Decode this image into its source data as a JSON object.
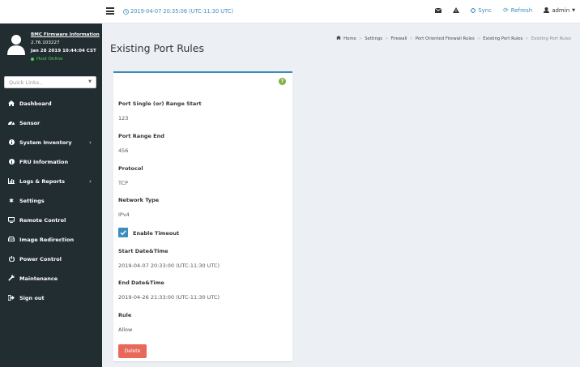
{
  "topbar": {
    "datetime": "2019-04-07 20:35:06 (UTC-11:30 UTC)",
    "sync_label": "Sync",
    "refresh_label": "Refresh",
    "user_label": "admin"
  },
  "user_panel": {
    "title": "BMC Firmware Information",
    "version": "2.76.103227",
    "build_date": "Jan 28 2019 10:44:04 CST",
    "host_status": "Host Online"
  },
  "quick_links": {
    "placeholder": "Quick Links.."
  },
  "sidebar": {
    "items": [
      {
        "label": "Dashboard",
        "icon": "dashboard-icon"
      },
      {
        "label": "Sensor",
        "icon": "sensor-icon"
      },
      {
        "label": "System Inventory",
        "icon": "info-icon",
        "has_arrow": true
      },
      {
        "label": "FRU Information",
        "icon": "info-icon"
      },
      {
        "label": "Logs & Reports",
        "icon": "chart-icon",
        "has_arrow": true
      },
      {
        "label": "Settings",
        "icon": "gear-icon"
      },
      {
        "label": "Remote Control",
        "icon": "monitor-icon"
      },
      {
        "label": "Image Redirection",
        "icon": "drive-icon"
      },
      {
        "label": "Power Control",
        "icon": "power-icon"
      },
      {
        "label": "Maintenance",
        "icon": "wrench-icon"
      },
      {
        "label": "Sign out",
        "icon": "sign-out-icon"
      }
    ]
  },
  "page": {
    "title": "Existing Port Rules"
  },
  "breadcrumb": [
    "Home",
    "Settings",
    "Firewall",
    "Port Oriented Firewall Rules",
    "Existing Port Rules",
    "Existing Port Rules"
  ],
  "form": {
    "port_start_label": "Port Single (or) Range Start",
    "port_start_value": "123",
    "port_end_label": "Port Range End",
    "port_end_value": "456",
    "protocol_label": "Protocol",
    "protocol_value": "TCP",
    "network_type_label": "Network Type",
    "network_type_value": "IPv4",
    "enable_timeout_label": "Enable Timeout",
    "enable_timeout_checked": true,
    "start_label": "Start Date&Time",
    "start_value": "2019-04-07 20:33:00 (UTC-11:30 UTC)",
    "end_label": "End Date&Time",
    "end_value": "2019-04-26 21:33:00 (UTC-11:30 UTC)",
    "rule_label": "Rule",
    "rule_value": "Allow",
    "delete_label": "Delete"
  },
  "colors": {
    "sidebar_bg": "#222d32",
    "accent": "#3c8dbc",
    "delete": "#e8685a",
    "online": "#4bd14b"
  }
}
